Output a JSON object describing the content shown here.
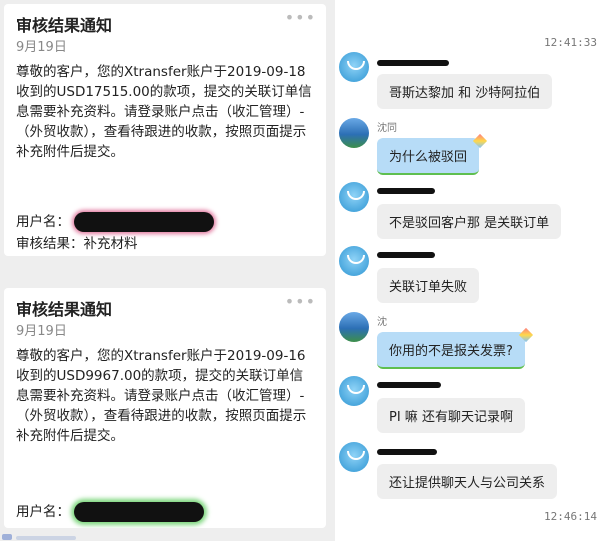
{
  "cards": [
    {
      "title": "审核结果通知",
      "date": "9月19日",
      "more": "•••",
      "body": "尊敬的客户，您的Xtransfer账户于2019-09-18收到的USD17515.00的款项，提交的关联订单信息需要补充资料。请登录账户点击（收汇管理）-（外贸收款），查看待跟进的收款，按照页面提示补充附件后提交。",
      "username_label": "用户名：",
      "result_label": "审核结果：",
      "result_value": "补充材料"
    },
    {
      "title": "审核结果通知",
      "date": "9月19日",
      "more": "•••",
      "body": "尊敬的客户，您的Xtransfer账户于2019-09-16收到的USD9967.00的款项，提交的关联订单信息需要补充资料。请登录账户点击（收汇管理）-（外贸收款），查看待跟进的收款，按照页面提示补充附件后提交。",
      "username_label": "用户名："
    }
  ],
  "chat": {
    "times": [
      "12:41:33",
      "12:46:14"
    ],
    "messages": [
      {
        "sender": "bot",
        "text": "哥斯达黎加 和 沙特阿拉伯"
      },
      {
        "sender": "user",
        "name": "沈同",
        "text": "为什么被驳回"
      },
      {
        "sender": "bot",
        "text": "不是驳回客户那 是关联订单"
      },
      {
        "sender": "bot",
        "text": "关联订单失败"
      },
      {
        "sender": "user",
        "name": "沈",
        "text": "你用的不是报关发票?"
      },
      {
        "sender": "bot",
        "text": "PI 嘛 还有聊天记录啊"
      },
      {
        "sender": "bot",
        "text": "还让提供聊天人与公司关系"
      }
    ]
  },
  "icons": {
    "more": "more-dots-icon",
    "bot_avatar": "smiley-avatar-icon",
    "user_avatar": "landscape-avatar-icon",
    "kite": "kite-icon"
  },
  "colors": {
    "left_background": "#eeeeee",
    "bot_bubble": "#eeeeee",
    "user_bubble": "#b7dcf7",
    "user_bubble_underline": "#5fbf4f"
  }
}
